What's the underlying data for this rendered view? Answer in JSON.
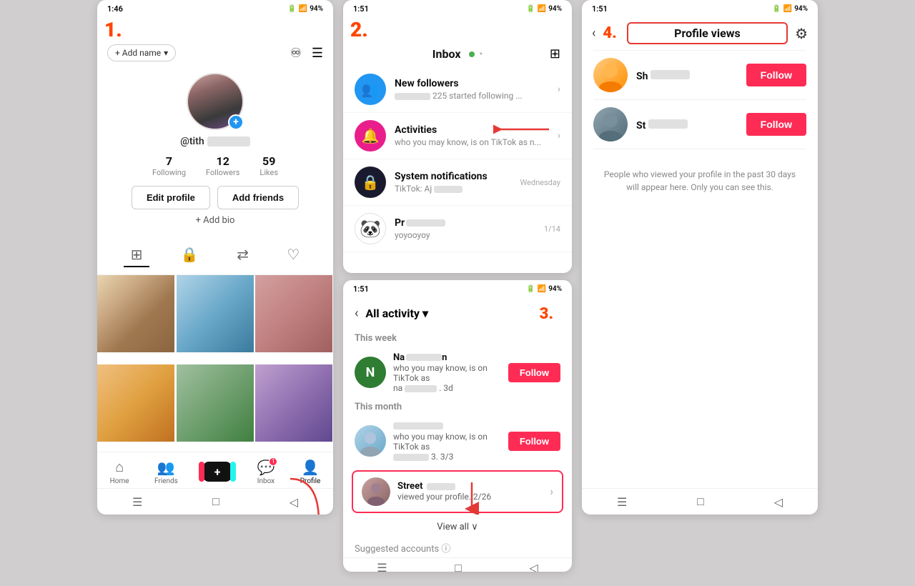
{
  "screen1": {
    "step": "1.",
    "status_time": "1:46",
    "status_battery": "94%",
    "add_name": "+ Add name",
    "username": "@tith",
    "stats": [
      {
        "num": "7",
        "label": "Following"
      },
      {
        "num": "12",
        "label": "Followers"
      },
      {
        "num": "59",
        "label": "Likes"
      }
    ],
    "btn_edit": "Edit profile",
    "btn_add": "Add friends",
    "add_bio": "+ Add bio",
    "nav_items": [
      {
        "label": "Home",
        "icon": "⌂"
      },
      {
        "label": "Friends",
        "icon": "👤"
      },
      {
        "label": "+",
        "icon": "+"
      },
      {
        "label": "Inbox",
        "icon": "💬"
      },
      {
        "label": "Profile",
        "icon": "👤"
      }
    ]
  },
  "screen2": {
    "step": "2.",
    "status_time": "1:51",
    "status_battery": "94%",
    "title": "Inbox",
    "items": [
      {
        "title": "New followers",
        "sub": "225 started following ...",
        "icon_type": "people",
        "has_chevron": true
      },
      {
        "title": "Activities",
        "sub": "who you may know, is on TikTok as n...",
        "icon_type": "bell",
        "has_chevron": true,
        "arrow": true
      },
      {
        "title": "System notifications",
        "sub": "TikTok: Aj",
        "icon_type": "lock",
        "timestamp": "Wednesday"
      },
      {
        "title": "Pr",
        "sub": "yoyooyoy",
        "icon_type": "panda",
        "timestamp": "1/14"
      }
    ]
  },
  "screen3": {
    "step": "3.",
    "status_time": "1:51",
    "status_battery": "94%",
    "title": "All activity",
    "dropdown": "▾",
    "this_week": "This week",
    "this_month": "This month",
    "activities": [
      {
        "name": "Na",
        "name_blur_width": 60,
        "desc_line1": "who you may know, is on",
        "desc_line2": "TikTok as",
        "time": "3d",
        "avatar_type": "letter",
        "avatar_letter": "N",
        "show_follow": true
      }
    ],
    "activities_month": [
      {
        "name": "",
        "name_blur_width": 80,
        "desc_line1": "who you may know, is on",
        "desc_line2": "TikTok as",
        "time": "3/3",
        "avatar_type": "photo",
        "show_follow": true
      }
    ],
    "street": {
      "name": "Street",
      "name_blur_width": 50,
      "sub": "viewed your profile. 2/26",
      "avatar_type": "photo"
    },
    "view_all": "View all ∨",
    "suggested": "Suggested accounts ⓘ"
  },
  "screen4": {
    "step": "4.",
    "status_time": "1:51",
    "status_battery": "94%",
    "title": "Profile views",
    "viewers": [
      {
        "name_prefix": "Sh",
        "name_blur_width": 60,
        "avatar_type": "warm",
        "btn": "Follow"
      },
      {
        "name_prefix": "St",
        "name_blur_width": 60,
        "avatar_type": "cool",
        "btn": "Follow"
      }
    ],
    "description": "People who viewed your profile in the past 30 days will appear here. Only you can see this."
  },
  "icons": {
    "people": "👥",
    "bell": "🔔",
    "lock": "🔒",
    "panda": "🐼",
    "chevron": "›",
    "back": "‹",
    "gear": "⚙",
    "plus": "+",
    "home": "⌂",
    "bars": "☰",
    "bookmark": "🔖",
    "grid": "⊞"
  }
}
